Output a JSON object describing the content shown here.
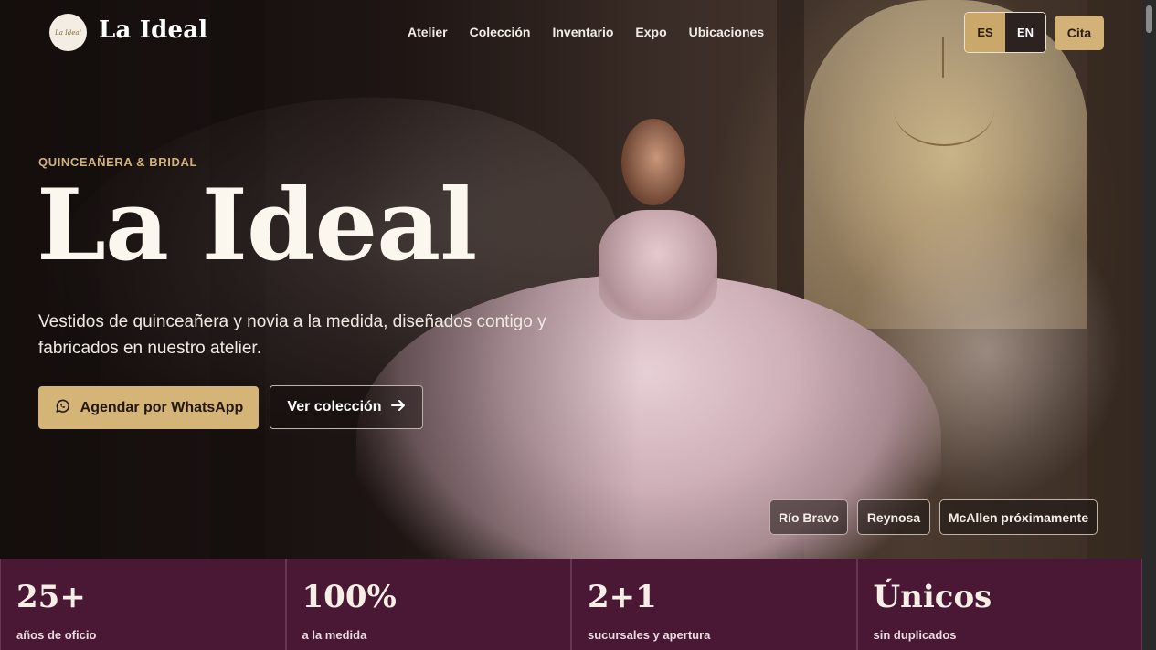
{
  "brand": {
    "name": "La Ideal",
    "logo_text": "La Ideal"
  },
  "nav": {
    "items": [
      "Atelier",
      "Colección",
      "Inventario",
      "Expo",
      "Ubicaciones"
    ]
  },
  "lang": {
    "es": "ES",
    "en": "EN",
    "active": "ES"
  },
  "cta_header": "Cita",
  "hero": {
    "eyebrow": "QUINCEAÑERA & BRIDAL",
    "title": "La Ideal",
    "description": "Vestidos de quinceañera y novia a la medida, diseñados contigo y fabricados en nuestro atelier.",
    "primary_button": "Agendar por WhatsApp",
    "secondary_button": "Ver colección",
    "locations": [
      "Río Bravo",
      "Reynosa",
      "McAllen próximamente"
    ]
  },
  "stats": [
    {
      "value": "25+",
      "label": "años de oficio"
    },
    {
      "value": "100%",
      "label": "a la medida"
    },
    {
      "value": "2+1",
      "label": "sucursales y apertura"
    },
    {
      "value": "Únicos",
      "label": "sin duplicados"
    }
  ],
  "colors": {
    "accent": "#d4b477",
    "stats_bg": "#4a1834",
    "eyebrow": "#d3b27a"
  },
  "icons": {
    "whatsapp": "whatsapp-icon",
    "arrow": "arrow-right-icon"
  }
}
